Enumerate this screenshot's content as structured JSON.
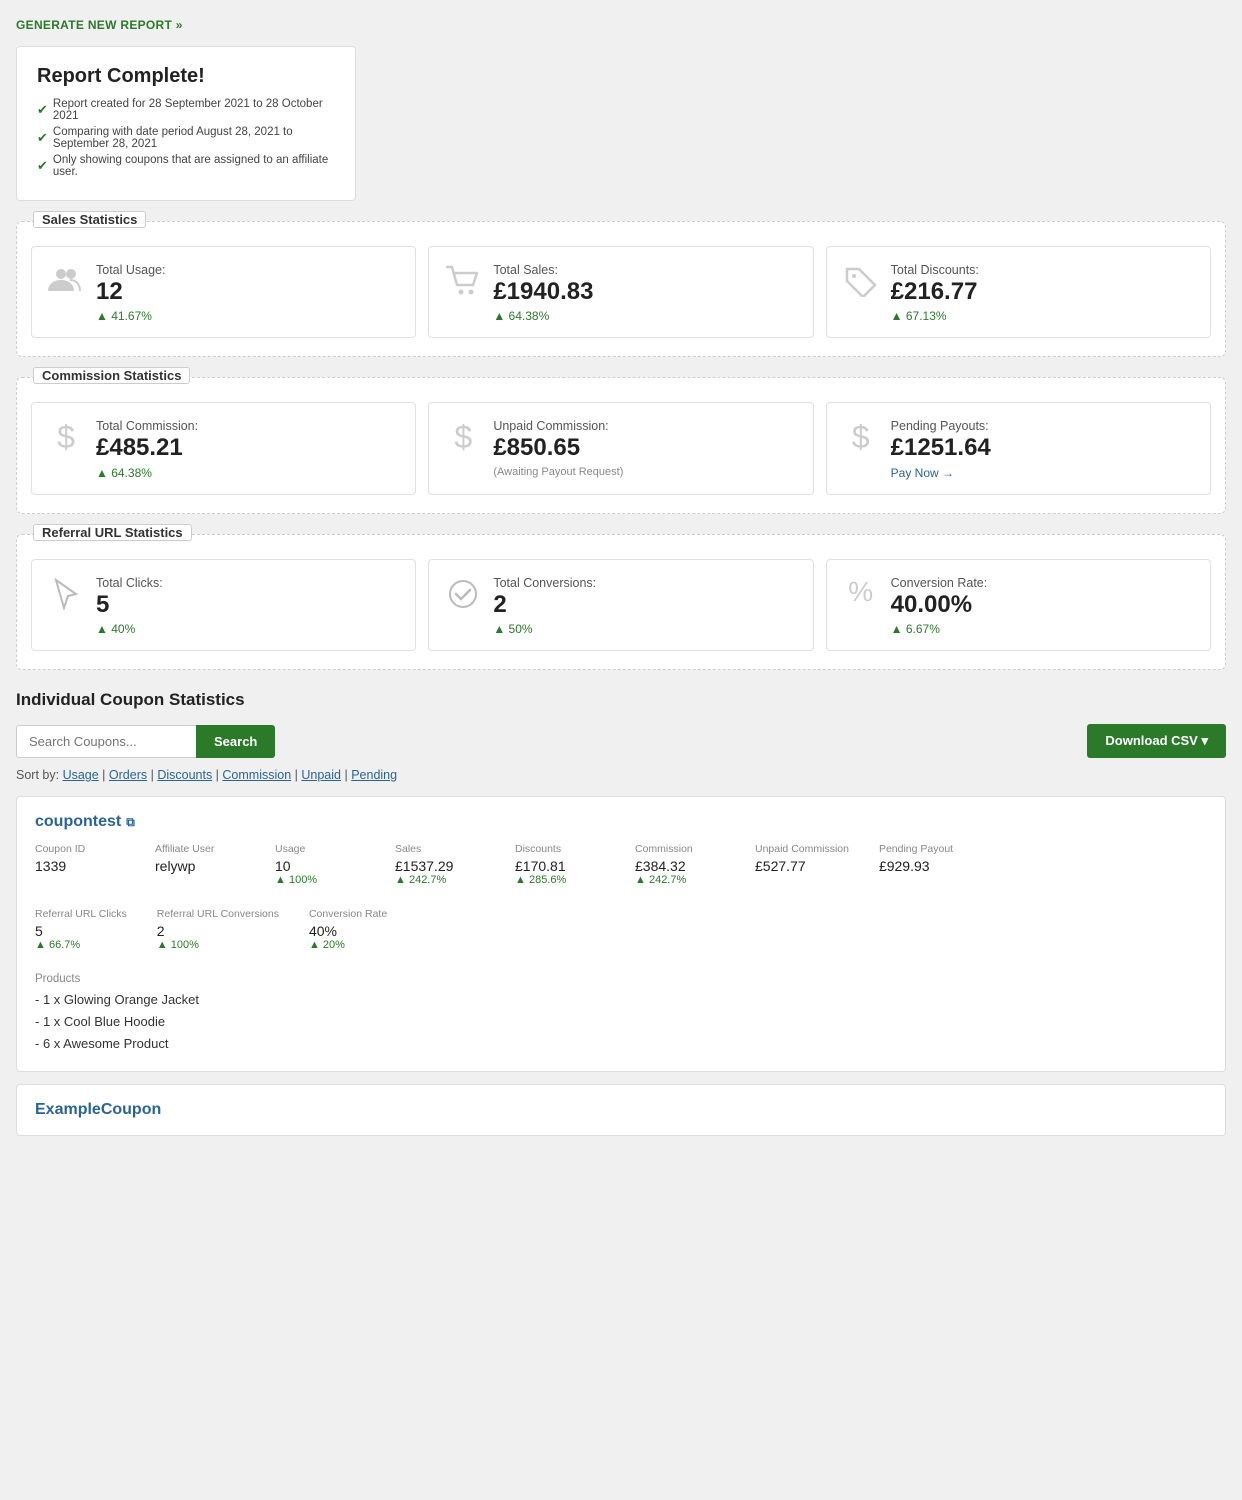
{
  "generate_link": "GENERATE NEW REPORT »",
  "report": {
    "title": "Report Complete!",
    "lines": [
      "Report created for 28 September 2021 to 28 October 2021",
      "Comparing with date period August 28, 2021 to September 28, 2021",
      "Only showing coupons that are assigned to an affiliate user."
    ]
  },
  "sales_statistics": {
    "section_title": "Sales Statistics",
    "cards": [
      {
        "icon": "👥",
        "label": "Total Usage:",
        "value": "12",
        "change": "41.67%",
        "note": ""
      },
      {
        "icon": "🛒",
        "label": "Total Sales:",
        "value": "£1940.83",
        "change": "64.38%",
        "note": ""
      },
      {
        "icon": "🏷️",
        "label": "Total Discounts:",
        "value": "£216.77",
        "change": "67.13%",
        "note": ""
      }
    ]
  },
  "commission_statistics": {
    "section_title": "Commission Statistics",
    "cards": [
      {
        "icon": "$",
        "label": "Total Commission:",
        "value": "£485.21",
        "change": "64.38%",
        "note": "",
        "pay_now": false
      },
      {
        "icon": "$",
        "label": "Unpaid Commission:",
        "value": "£850.65",
        "change": "",
        "note": "(Awaiting Payout Request)",
        "pay_now": false
      },
      {
        "icon": "$",
        "label": "Pending Payouts:",
        "value": "£1251.64",
        "change": "",
        "note": "",
        "pay_now": true,
        "pay_now_label": "Pay Now →"
      }
    ]
  },
  "referral_statistics": {
    "section_title": "Referral URL Statistics",
    "cards": [
      {
        "icon": "▷",
        "label": "Total Clicks:",
        "value": "5",
        "change": "40%",
        "note": ""
      },
      {
        "icon": "✓",
        "label": "Total Conversions:",
        "value": "2",
        "change": "50%",
        "note": ""
      },
      {
        "icon": "%",
        "label": "Conversion Rate:",
        "value": "40.00%",
        "change": "6.67%",
        "note": ""
      }
    ]
  },
  "individual": {
    "title": "Individual Coupon Statistics",
    "search_placeholder": "Search Coupons...",
    "search_label": "Search",
    "download_label": "Download CSV ▾",
    "sort_label": "Sort by:",
    "sort_options": [
      "Usage",
      "Orders",
      "Discounts",
      "Commission",
      "Unpaid",
      "Pending"
    ],
    "sort_active": "Usage"
  },
  "coupons": [
    {
      "name": "coupontest",
      "coupon_id_label": "Coupon ID",
      "coupon_id": "1339",
      "affiliate_user_label": "Affiliate User",
      "affiliate_user": "relywp",
      "usage_label": "Usage",
      "usage": "10",
      "usage_change": "100%",
      "sales_label": "Sales",
      "sales": "£1537.29",
      "sales_change": "242.7%",
      "discounts_label": "Discounts",
      "discounts": "£170.81",
      "discounts_change": "285.6%",
      "commission_label": "Commission",
      "commission": "£384.32",
      "commission_change": "242.7%",
      "unpaid_commission_label": "Unpaid Commission",
      "unpaid_commission": "£527.77",
      "pending_payout_label": "Pending Payout",
      "pending_payout": "£929.93",
      "referral_clicks_label": "Referral URL Clicks",
      "referral_clicks": "5",
      "referral_clicks_change": "66.7%",
      "referral_conversions_label": "Referral URL Conversions",
      "referral_conversions": "2",
      "referral_conversions_change": "100%",
      "conversion_rate_label": "Conversion Rate",
      "conversion_rate": "40%",
      "conversion_rate_change": "20%",
      "products_label": "Products",
      "products": [
        "- 1 x Glowing Orange Jacket",
        "- 1 x Cool Blue Hoodie",
        "- 6 x Awesome Product"
      ]
    }
  ],
  "partial_coupon": {
    "name": "ExampleCoupon"
  }
}
